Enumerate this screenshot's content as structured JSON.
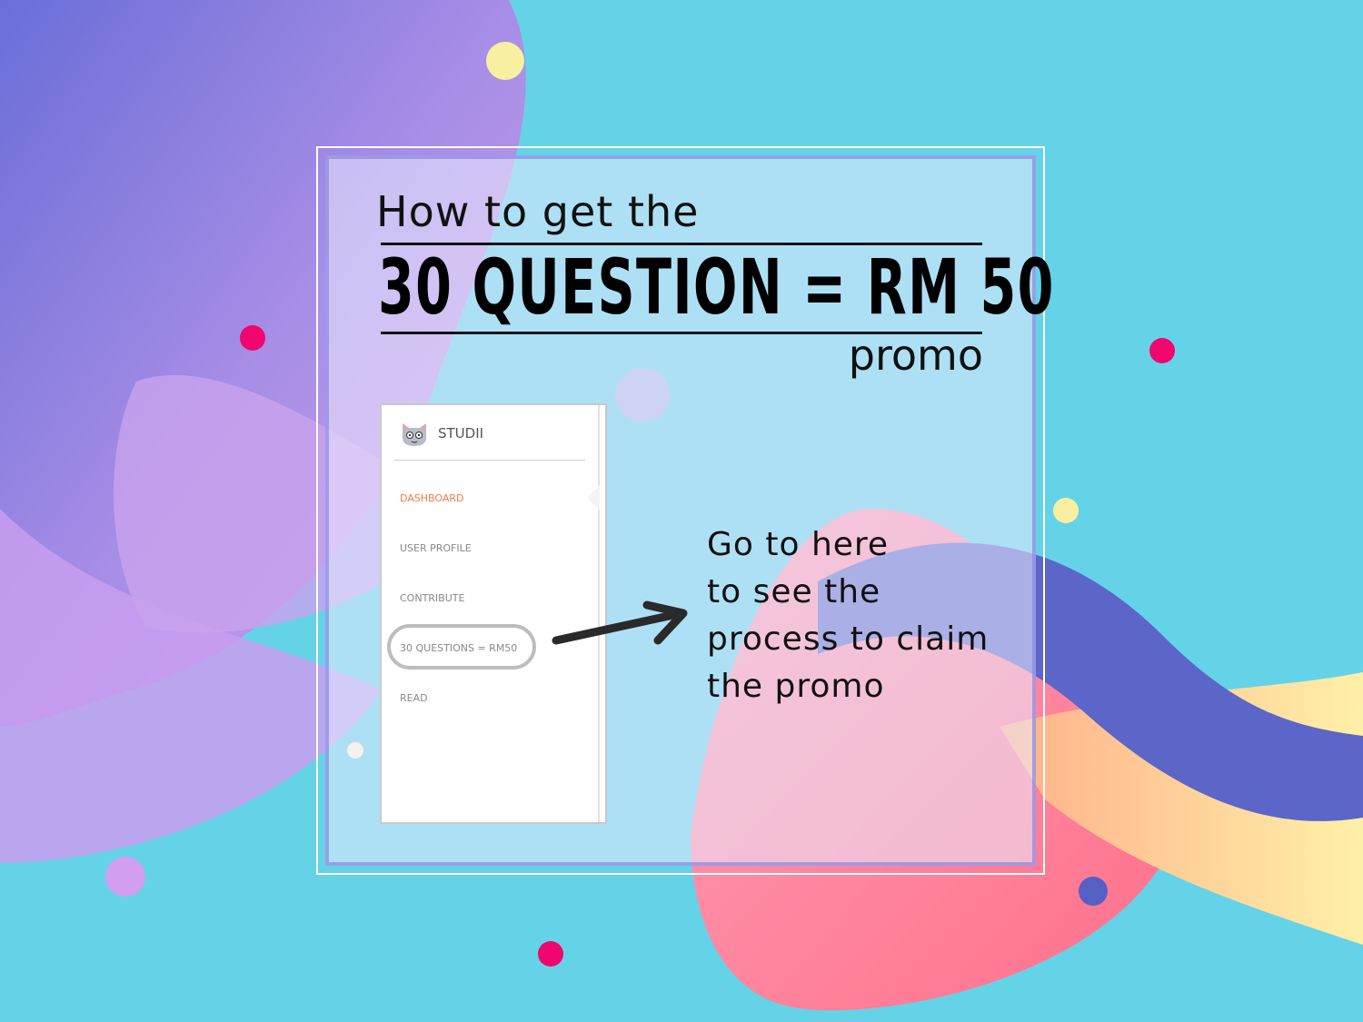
{
  "headline": {
    "line1": "How to get the",
    "line2": "30 QUESTION = RM 50",
    "line3": "promo"
  },
  "sidebar": {
    "brand": "STUDII",
    "brand_icon": "cat-icon",
    "active_color": "#f07850",
    "items": [
      {
        "label": "DASHBOARD",
        "active": true
      },
      {
        "label": "USER PROFILE"
      },
      {
        "label": "CONTRIBUTE"
      },
      {
        "label": "30 QUESTIONS = RM50",
        "highlighted": true
      },
      {
        "label": "READ"
      }
    ]
  },
  "note": {
    "lines": [
      "Go to here",
      "to see the",
      "process to claim",
      "the promo"
    ],
    "arrow_icon": "arrow-right-icon"
  },
  "colors": {
    "background": "#64d3e8",
    "purple": "#8b6fd6",
    "pink": "#ff6f8f",
    "dot_magenta": "#f0066e",
    "dot_yellow": "#f8f0a0"
  }
}
